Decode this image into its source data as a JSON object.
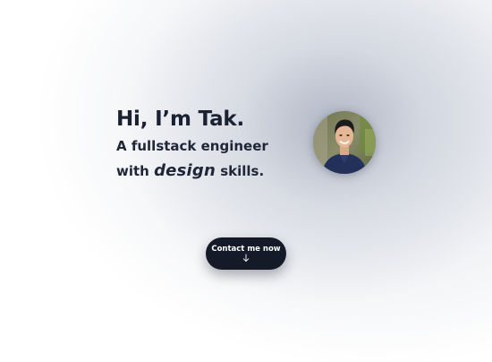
{
  "hero": {
    "greeting": "Hi, I’m Tak.",
    "tagline_line1": "A fullstack engineer",
    "tagline_with": "with ",
    "tagline_emphasis": "design",
    "tagline_rest": " skills.",
    "avatar_icon": "profile-photo",
    "contact_label": "Contact me now",
    "contact_icon": "arrow-down-icon"
  },
  "colors": {
    "text": "#1a2131",
    "button_bg": "#141a28",
    "button_text": "#ffffff"
  }
}
